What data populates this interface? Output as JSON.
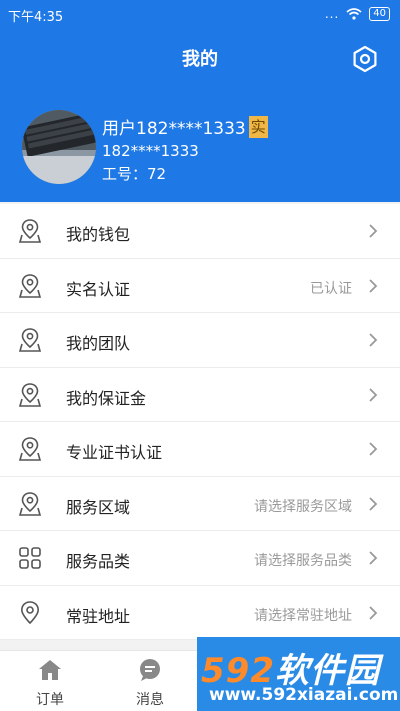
{
  "status_bar": {
    "time": "下午4:35",
    "dots": "...",
    "battery": "40"
  },
  "header": {
    "title": "我的",
    "settings_icon": "hexagon-settings-icon",
    "background": "#1e78e6"
  },
  "user": {
    "name": "用户182****1333",
    "verified_badge": "实",
    "phone": "182****1333",
    "employee_id_label": "工号：",
    "employee_id": "72"
  },
  "menu": [
    {
      "label": "我的钱包",
      "value": "",
      "icon": "location-pin-icon"
    },
    {
      "label": "实名认证",
      "value": "已认证",
      "icon": "location-pin-icon"
    },
    {
      "label": "我的团队",
      "value": "",
      "icon": "location-pin-icon"
    },
    {
      "label": "我的保证金",
      "value": "",
      "icon": "location-pin-icon"
    },
    {
      "label": "专业证书认证",
      "value": "",
      "icon": "location-pin-icon"
    },
    {
      "label": "服务区域",
      "value": "请选择服务区域",
      "icon": "location-pin-icon"
    },
    {
      "label": "服务品类",
      "value": "请选择服务品类",
      "icon": "grid-icon"
    },
    {
      "label": "常驻地址",
      "value": "请选择常驻地址",
      "icon": "map-pin-icon"
    }
  ],
  "tabbar": [
    {
      "label": "订单",
      "icon": "home-icon"
    },
    {
      "label": "消息",
      "icon": "chat-icon"
    }
  ],
  "watermark": {
    "brand_num": "592",
    "brand_text": "软件园",
    "url": "www.592xiazai.com"
  }
}
